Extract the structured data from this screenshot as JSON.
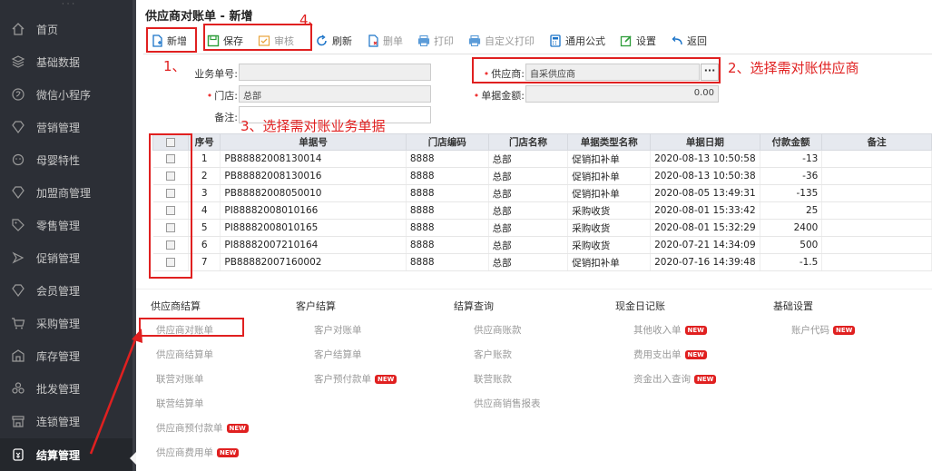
{
  "sidebar": {
    "items": [
      {
        "label": "首页",
        "icon": "home-icon"
      },
      {
        "label": "基础数据",
        "icon": "stack-icon"
      },
      {
        "label": "微信小程序",
        "icon": "wechat-icon"
      },
      {
        "label": "营销管理",
        "icon": "diamond-icon"
      },
      {
        "label": "母婴特性",
        "icon": "baby-icon"
      },
      {
        "label": "加盟商管理",
        "icon": "diamond-icon"
      },
      {
        "label": "零售管理",
        "icon": "tag-icon"
      },
      {
        "label": "促销管理",
        "icon": "promo-icon"
      },
      {
        "label": "会员管理",
        "icon": "diamond-icon"
      },
      {
        "label": "采购管理",
        "icon": "cart-icon"
      },
      {
        "label": "库存管理",
        "icon": "warehouse-icon"
      },
      {
        "label": "批发管理",
        "icon": "cluster-icon"
      },
      {
        "label": "连锁管理",
        "icon": "store-icon"
      },
      {
        "label": "结算管理",
        "icon": "settle-icon"
      }
    ]
  },
  "page": {
    "title": "供应商对账单 - 新增"
  },
  "toolbar": {
    "new": "新增",
    "save": "保存",
    "audit": "审核",
    "refresh": "刷新",
    "delete": "删单",
    "print": "打印",
    "custom_print": "自定义打印",
    "formula": "通用公式",
    "settings": "设置",
    "back": "返回"
  },
  "form": {
    "doc_no_label": "业务单号:",
    "doc_no_value": "",
    "store_label": "门店:",
    "store_value": "总部",
    "remark_label": "备注:",
    "remark_value": "",
    "supplier_label": "供应商:",
    "supplier_value": "自采供应商",
    "amount_label": "单据金额:",
    "amount_value": "0.00",
    "more": "···"
  },
  "table": {
    "headers": [
      "序号",
      "单据号",
      "门店编码",
      "门店名称",
      "单据类型名称",
      "单据日期",
      "付款金额",
      "备注"
    ],
    "rows": [
      {
        "seq": "1",
        "no": "PB88882008130014",
        "code": "8888",
        "name": "总部",
        "type": "促销扣补单",
        "date": "2020-08-13 10:50:58",
        "amount": "-13",
        "remark": ""
      },
      {
        "seq": "2",
        "no": "PB88882008130016",
        "code": "8888",
        "name": "总部",
        "type": "促销扣补单",
        "date": "2020-08-13 10:50:38",
        "amount": "-36",
        "remark": ""
      },
      {
        "seq": "3",
        "no": "PB88882008050010",
        "code": "8888",
        "name": "总部",
        "type": "促销扣补单",
        "date": "2020-08-05 13:49:31",
        "amount": "-135",
        "remark": ""
      },
      {
        "seq": "4",
        "no": "PI88882008010166",
        "code": "8888",
        "name": "总部",
        "type": "采购收货",
        "date": "2020-08-01 15:33:42",
        "amount": "25",
        "remark": ""
      },
      {
        "seq": "5",
        "no": "PI88882008010165",
        "code": "8888",
        "name": "总部",
        "type": "采购收货",
        "date": "2020-08-01 15:32:29",
        "amount": "2400",
        "remark": ""
      },
      {
        "seq": "6",
        "no": "PI88882007210164",
        "code": "8888",
        "name": "总部",
        "type": "采购收货",
        "date": "2020-07-21 14:34:09",
        "amount": "500",
        "remark": ""
      },
      {
        "seq": "7",
        "no": "PB88882007160002",
        "code": "8888",
        "name": "总部",
        "type": "促销扣补单",
        "date": "2020-07-16 14:39:48",
        "amount": "-1.5",
        "remark": ""
      }
    ]
  },
  "menu": {
    "badge": "NEW",
    "columns": [
      {
        "title": "供应商结算",
        "items": [
          {
            "label": "供应商对账单",
            "new": false
          },
          {
            "label": "供应商结算单",
            "new": false
          },
          {
            "label": "联营对账单",
            "new": false
          },
          {
            "label": "联营结算单",
            "new": false
          },
          {
            "label": "供应商预付款单",
            "new": true
          },
          {
            "label": "供应商费用单",
            "new": true
          }
        ]
      },
      {
        "title": "客户结算",
        "items": [
          {
            "label": "客户对账单",
            "new": false
          },
          {
            "label": "客户结算单",
            "new": false
          },
          {
            "label": "客户预付款单",
            "new": true
          }
        ]
      },
      {
        "title": "结算查询",
        "items": [
          {
            "label": "供应商账款",
            "new": false
          },
          {
            "label": "客户账款",
            "new": false
          },
          {
            "label": "联营账款",
            "new": false
          },
          {
            "label": "供应商销售报表",
            "new": false
          }
        ]
      },
      {
        "title": "现金日记账",
        "items": [
          {
            "label": "其他收入单",
            "new": true
          },
          {
            "label": "费用支出单",
            "new": true
          },
          {
            "label": "资金出入查询",
            "new": true
          }
        ]
      },
      {
        "title": "基础设置",
        "items": [
          {
            "label": "账户代码",
            "new": true
          }
        ]
      }
    ]
  },
  "annotations": {
    "step1": "1、",
    "step2": "2、选择需对账供应商",
    "step3": "3、选择需对账业务单据",
    "step4": "4、"
  },
  "colors": {
    "sidebar_bg": "#2c2f36",
    "annotation": "#e02020",
    "header_bg": "#e6e9ef",
    "badge": "#e02020"
  }
}
